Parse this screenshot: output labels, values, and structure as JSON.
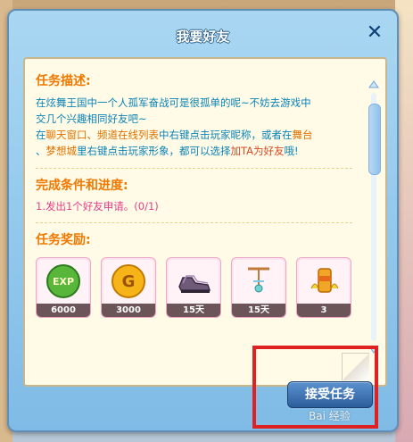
{
  "dialog": {
    "title": "我要好友",
    "close_icon": "close-icon",
    "accept_label": "接受任务"
  },
  "task": {
    "desc_heading": "任务描述:",
    "desc_line1": "在炫舞王国中一个人孤军奋战可是很孤单的呢~不妨去游戏中",
    "desc_line2": "交几个兴趣相同好友吧~",
    "desc_line3_a": "在",
    "desc_line3_b": "聊天窗口、频道在线列表",
    "desc_line3_c": "中右键点击玩家昵称，或者在",
    "desc_line3_d": "舞台",
    "desc_line4_a": "、",
    "desc_line4_b": "梦想城",
    "desc_line4_c": "里右键点击玩家形象，都可以选择",
    "desc_line4_d": "加TA为好友",
    "desc_line4_e": "哦!",
    "cond_heading": "完成条件和进度:",
    "cond_item": "1.发出1个好友申请。(0/1)",
    "reward_heading": "任务奖励:"
  },
  "rewards": [
    {
      "icon": "exp-icon",
      "label": "EXP",
      "amount": "6000"
    },
    {
      "icon": "gold-coin-icon",
      "label": "G",
      "amount": "3000"
    },
    {
      "icon": "shoes-icon",
      "label": "",
      "amount": "15天"
    },
    {
      "icon": "necklace-icon",
      "label": "",
      "amount": "15天"
    },
    {
      "icon": "drink-can-icon",
      "label": "",
      "amount": "3"
    }
  ],
  "watermark": "Bai 经验"
}
